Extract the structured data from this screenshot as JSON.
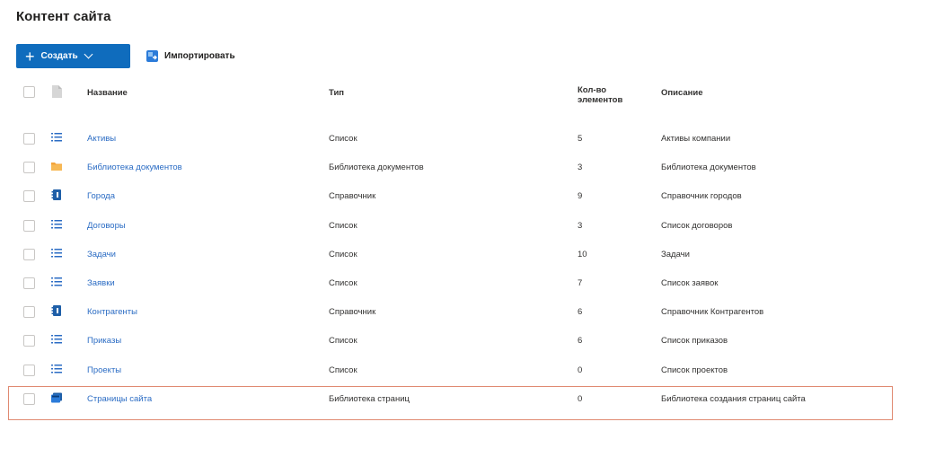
{
  "page": {
    "title": "Контент сайта"
  },
  "toolbar": {
    "create_label": "Создать",
    "import_label": "Импортировать"
  },
  "table": {
    "headers": {
      "name": "Название",
      "type": "Тип",
      "count_line1": "Кол-во",
      "count_line2": "элементов",
      "description": "Описание"
    },
    "rows": [
      {
        "icon": "list-icon",
        "name": "Активы",
        "type": "Список",
        "count": "5",
        "description": "Активы компании"
      },
      {
        "icon": "folder-icon",
        "name": "Библиотека документов",
        "type": "Библиотека документов",
        "count": "3",
        "description": "Библиотека документов"
      },
      {
        "icon": "directory-icon",
        "name": "Города",
        "type": "Справочник",
        "count": "9",
        "description": "Справочник городов"
      },
      {
        "icon": "list-icon",
        "name": "Договоры",
        "type": "Список",
        "count": "3",
        "description": "Список договоров"
      },
      {
        "icon": "list-icon",
        "name": "Задачи",
        "type": "Список",
        "count": "10",
        "description": "Задачи"
      },
      {
        "icon": "list-icon",
        "name": "Заявки",
        "type": "Список",
        "count": "7",
        "description": "Список заявок"
      },
      {
        "icon": "directory-icon",
        "name": "Контрагенты",
        "type": "Справочник",
        "count": "6",
        "description": "Справочник Контрагентов"
      },
      {
        "icon": "list-icon",
        "name": "Приказы",
        "type": "Список",
        "count": "6",
        "description": "Список приказов"
      },
      {
        "icon": "list-icon",
        "name": "Проекты",
        "type": "Список",
        "count": "0",
        "description": "Список проектов"
      },
      {
        "icon": "pages-library-icon",
        "name": "Страницы сайта",
        "type": "Библиотека страниц",
        "count": "0",
        "description": "Библиотека создания страниц сайта"
      }
    ]
  },
  "colors": {
    "accent": "#0f6cbd",
    "link": "#2b6cc4",
    "highlight_border": "#e08a72"
  }
}
